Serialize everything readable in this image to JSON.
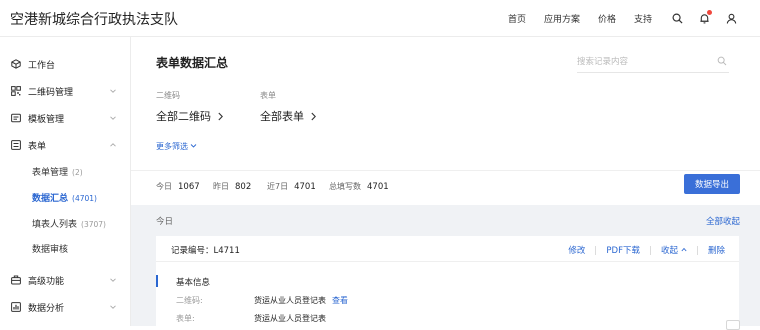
{
  "header": {
    "org_name": "空港新城综合行政执法支队",
    "nav": [
      "首页",
      "应用方案",
      "价格",
      "支持"
    ],
    "icons": [
      "search-icon",
      "bell-icon",
      "user-icon"
    ]
  },
  "sidebar": {
    "items": [
      {
        "label": "工作台",
        "icon": "workbench-icon"
      },
      {
        "label": "二维码管理",
        "icon": "qrcode-icon"
      },
      {
        "label": "模板管理",
        "icon": "template-icon"
      },
      {
        "label": "表单",
        "icon": "form-icon"
      },
      {
        "label": "高级功能",
        "icon": "briefcase-icon"
      },
      {
        "label": "数据分析",
        "icon": "analytics-icon"
      }
    ],
    "sub_items": [
      {
        "label": "表单管理",
        "count": "(2)"
      },
      {
        "label": "数据汇总",
        "count": "(4701)"
      },
      {
        "label": "填表人列表",
        "count": "(3707)"
      },
      {
        "label": "数据审核",
        "count": ""
      }
    ]
  },
  "main": {
    "title": "表单数据汇总",
    "search_placeholder": "搜索记录内容",
    "filters": [
      {
        "label": "二维码",
        "value": "全部二维码"
      },
      {
        "label": "表单",
        "value": "全部表单"
      }
    ],
    "more_filter": "更多筛选",
    "stats": [
      {
        "label": "今日",
        "value": "1067"
      },
      {
        "label": "昨日",
        "value": "802"
      },
      {
        "label": "近7日",
        "value": "4701"
      },
      {
        "label": "总填写数",
        "value": "4701"
      }
    ],
    "export_label": "数据导出",
    "day_label": "今日",
    "collapse_all": "全部收起",
    "record": {
      "number_text": "记录编号：L4711",
      "actions": [
        "修改",
        "PDF下载",
        "收起",
        "删除"
      ],
      "section_title": "基本信息",
      "fields": [
        {
          "key": "二维码:",
          "value": "货运从业人员登记表",
          "link": "查看"
        },
        {
          "key": "表单:",
          "value": "货运从业人员登记表",
          "link": ""
        }
      ]
    }
  },
  "colors": {
    "accent": "#2b67d1",
    "button": "#3a6fd8",
    "list_bg": "#f0f2f5"
  }
}
